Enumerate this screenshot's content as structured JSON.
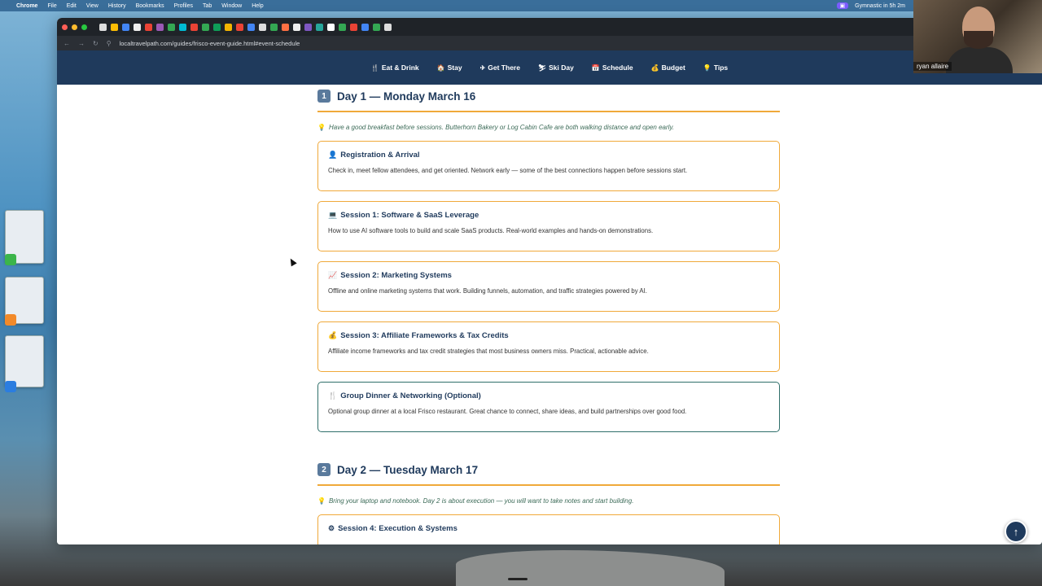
{
  "menubar": {
    "app": "Chrome",
    "items": [
      "File",
      "Edit",
      "View",
      "History",
      "Bookmarks",
      "Profiles",
      "Tab",
      "Window",
      "Help"
    ],
    "status": "Gymnastic in 5h 2m"
  },
  "webcam": {
    "name": "ryan allaire"
  },
  "browser": {
    "url": "localtravelpath.com/guides/frisco-event-guide.html#event-schedule"
  },
  "nav": {
    "items": [
      {
        "icon": "🍴",
        "label": "Eat & Drink"
      },
      {
        "icon": "🏠",
        "label": "Stay"
      },
      {
        "icon": "✈",
        "label": "Get There"
      },
      {
        "icon": "⛷",
        "label": "Ski Day"
      },
      {
        "icon": "📅",
        "label": "Schedule"
      },
      {
        "icon": "💰",
        "label": "Budget"
      },
      {
        "icon": "💡",
        "label": "Tips"
      }
    ]
  },
  "day1": {
    "num": "1",
    "title": "Day 1 — Monday March 16",
    "tip": "Have a good breakfast before sessions. Butterhorn Bakery or Log Cabin Cafe are both walking distance and open early.",
    "cards": [
      {
        "icon": "👤",
        "title": "Registration & Arrival",
        "desc": "Check in, meet fellow attendees, and get oriented. Network early — some of the best connections happen before sessions start."
      },
      {
        "icon": "💻",
        "title": "Session 1: Software & SaaS Leverage",
        "desc": "How to use AI software tools to build and scale SaaS products. Real-world examples and hands-on demonstrations."
      },
      {
        "icon": "📈",
        "title": "Session 2: Marketing Systems",
        "desc": "Offline and online marketing systems that work. Building funnels, automation, and traffic strategies powered by AI."
      },
      {
        "icon": "💰",
        "title": "Session 3: Affiliate Frameworks & Tax Credits",
        "desc": "Affiliate income frameworks and tax credit strategies that most business owners miss. Practical, actionable advice."
      },
      {
        "icon": "🍴",
        "title": "Group Dinner & Networking (Optional)",
        "desc": "Optional group dinner at a local Frisco restaurant. Great chance to connect, share ideas, and build partnerships over good food."
      }
    ]
  },
  "day2": {
    "num": "2",
    "title": "Day 2 — Tuesday March 17",
    "tip": "Bring your laptop and notebook. Day 2 is about execution — you will want to take notes and start building.",
    "cards": [
      {
        "icon": "⚙",
        "title": "Session 4: Execution & Systems"
      }
    ]
  },
  "scroll_top": {
    "icon": "↑"
  },
  "colors": {
    "nav_bg": "#1f3a5c",
    "accent_orange": "#f0a93a",
    "accent_teal": "#2f6f6a"
  }
}
